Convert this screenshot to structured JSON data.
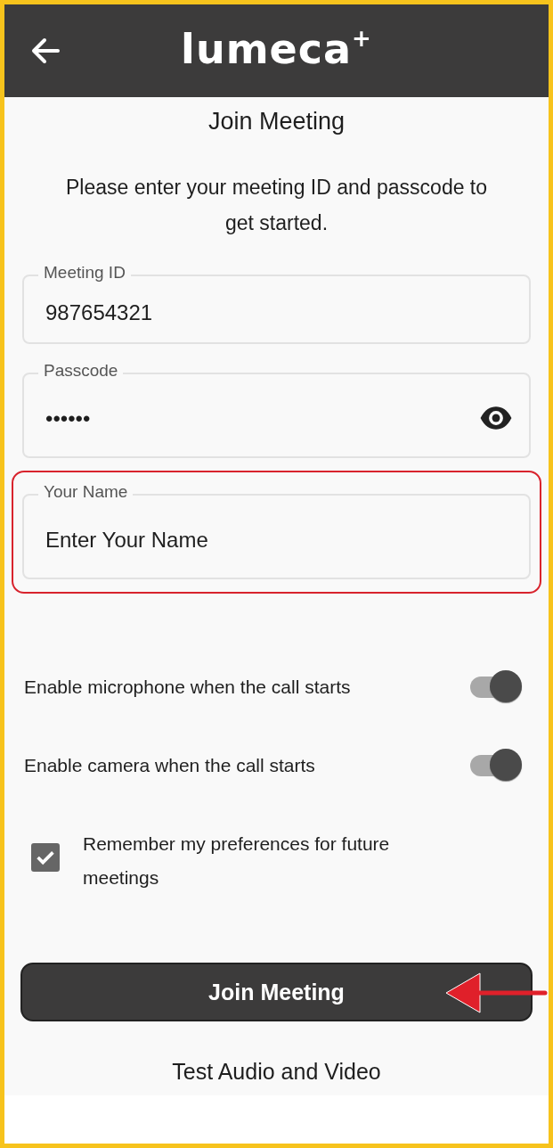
{
  "header": {
    "logo": "lumeca",
    "logo_mark": "+"
  },
  "title": "Join Meeting",
  "subtitle": "Please enter your meeting ID and passcode to get started.",
  "fields": [
    {
      "kind": "text",
      "label": "Meeting ID",
      "value": "987654321",
      "highlighted": false
    },
    {
      "kind": "password",
      "label": "Passcode",
      "value": "••••••",
      "highlighted": false
    },
    {
      "kind": "text",
      "label": "Your Name",
      "placeholder": "Enter Your Name",
      "highlighted": true
    }
  ],
  "toggles": [
    {
      "label": "Enable microphone when the call starts",
      "on": true
    },
    {
      "label": "Enable camera when the call starts",
      "on": true
    }
  ],
  "remember": {
    "label": "Remember my preferences for future meetings",
    "checked": true
  },
  "join_button": {
    "label": "Join Meeting",
    "pointed_at": true
  },
  "test_link": "Test Audio and Video"
}
